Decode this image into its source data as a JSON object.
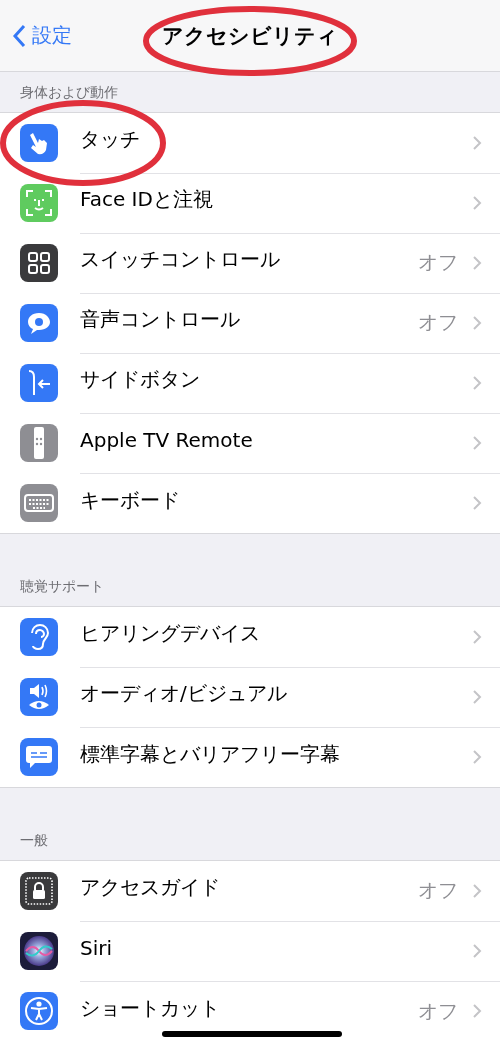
{
  "nav": {
    "back_label": "設定",
    "title": "アクセシビリティ"
  },
  "sections": [
    {
      "header": "身体および動作",
      "items": [
        {
          "label": "タッチ",
          "kind": "touch",
          "color": "#3478f6"
        },
        {
          "label": "Face IDと注視",
          "kind": "face",
          "color": "#5fcb5f"
        },
        {
          "label": "スイッチコントロール",
          "kind": "switch",
          "color": "#3a3a3c",
          "detail": "オフ"
        },
        {
          "label": "音声コントロール",
          "kind": "voice",
          "color": "#3478f6",
          "detail": "オフ"
        },
        {
          "label": "サイドボタン",
          "kind": "side",
          "color": "#3478f6"
        },
        {
          "label": "Apple TV Remote",
          "kind": "remote",
          "color": "#8e8e93"
        },
        {
          "label": "キーボード",
          "kind": "keyboard",
          "color": "#8e8e93"
        }
      ]
    },
    {
      "header": "聴覚サポート",
      "items": [
        {
          "label": "ヒアリングデバイス",
          "kind": "ear",
          "color": "#3478f6"
        },
        {
          "label": "オーディオ/ビジュアル",
          "kind": "audiovisual",
          "color": "#3478f6"
        },
        {
          "label": "標準字幕とバリアフリー字幕",
          "kind": "captions",
          "color": "#3478f6"
        }
      ]
    },
    {
      "header": "一般",
      "items": [
        {
          "label": "アクセスガイド",
          "kind": "lock",
          "color": "#3a3a3c",
          "detail": "オフ"
        },
        {
          "label": "Siri",
          "kind": "siri",
          "color": "#1c1c3a"
        },
        {
          "label": "ショートカット",
          "kind": "person",
          "color": "#3478f6",
          "detail": "オフ"
        }
      ]
    }
  ]
}
